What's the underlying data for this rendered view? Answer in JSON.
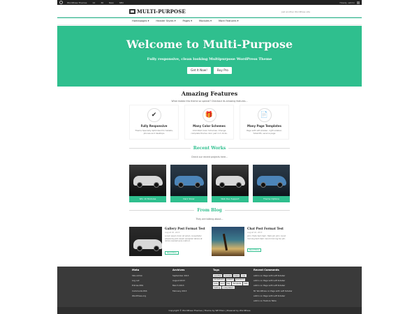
{
  "admin_bar": {
    "items": [
      "WordPress Themes",
      "12",
      "36",
      "New",
      "SEO"
    ],
    "user": "Howdy, admin"
  },
  "header": {
    "logo_text": "MULTI-PURPOSE",
    "tagline": "Just another WordPress site"
  },
  "nav": {
    "items": [
      "Homepages",
      "Header Styles",
      "Pages",
      "Modules",
      "More Features"
    ]
  },
  "hero": {
    "title": "Welcome to Multi-Purpose",
    "subtitle": "Fully responsive, clean looking Multipurpose WordPress Theme",
    "btn_primary": "Get It Now!",
    "btn_secondary": "Buy Pro"
  },
  "features": {
    "title": "Amazing Features",
    "subtitle": "What makes this theme so special? Checkout its amazing features...",
    "items": [
      {
        "icon": "check-icon",
        "title": "Fully Responsive",
        "desc": "Theme Specially Optimized for tablets, phones and desktops"
      },
      {
        "icon": "gift-icon",
        "title": "Many Color Schemes",
        "desc": "Unlimited Color Schemes. Change complete theme color just in 2 clicks."
      },
      {
        "icon": "document-icon",
        "title": "Many Page Templates",
        "desc": "Page with left sidebar, right sidebar, fullwidth, service page"
      }
    ]
  },
  "works": {
    "title": "Recent Works",
    "subtitle": "Check our recent projects here...",
    "items": [
      "Wix 10 Modules",
      "Dark Silver",
      "Web Dev Support",
      "Theme Options"
    ]
  },
  "blog": {
    "title": "From Blog",
    "subtitle": "They are talking about...",
    "posts": [
      {
        "title": "Gallery Post Format Test",
        "meta": "August 20, 2013",
        "excerpt": "Lorem ipsum dolor sit amet, consectetur adipisicing elit. Quam excepturi labore et dolore eveniet quis nostrud.",
        "read_more": "Read More"
      },
      {
        "title": "Chat Post Format Test",
        "meta": "August 20, 2013",
        "excerpt": "John: Hello Sam Sam: Hello Jim John: Good morning Sam Sam: Good morning too Jim.",
        "read_more": "Read More"
      }
    ]
  },
  "footer": {
    "meta": {
      "title": "Meta",
      "items": [
        "Site Admin",
        "Log out",
        "Entries RSS",
        "Comments RSS",
        "WordPress.org"
      ]
    },
    "archives": {
      "title": "Archives",
      "items": [
        "September 2013",
        "August 2013",
        "March 2013",
        "February 2013"
      ]
    },
    "tags": {
      "title": "Tags",
      "items": [
        "weather",
        "Canvas",
        "blaze",
        "one",
        "perpetuum",
        "poised",
        "premium",
        "quis",
        "sed",
        "tag",
        "Template",
        "test",
        "testing",
        "voluptatem"
      ]
    },
    "comments": {
      "title": "Recent Comments",
      "items": [
        "admin on Page with Left Sidebar",
        "admin on Page with Left Sidebar",
        "admin on Page with Left Sidebar",
        "Mr WordPress on Page with Left Sidebar",
        "admin on Page with Left Sidebar",
        "admin on Feature Table"
      ]
    },
    "copyright": "Copyright © WordPress Themes | Theme by WP Eden | Powered by WordPress"
  },
  "colors": {
    "accent": "#2fbf8e",
    "footer_bg": "#3a3a3a",
    "adminbar_bg": "#222222"
  }
}
